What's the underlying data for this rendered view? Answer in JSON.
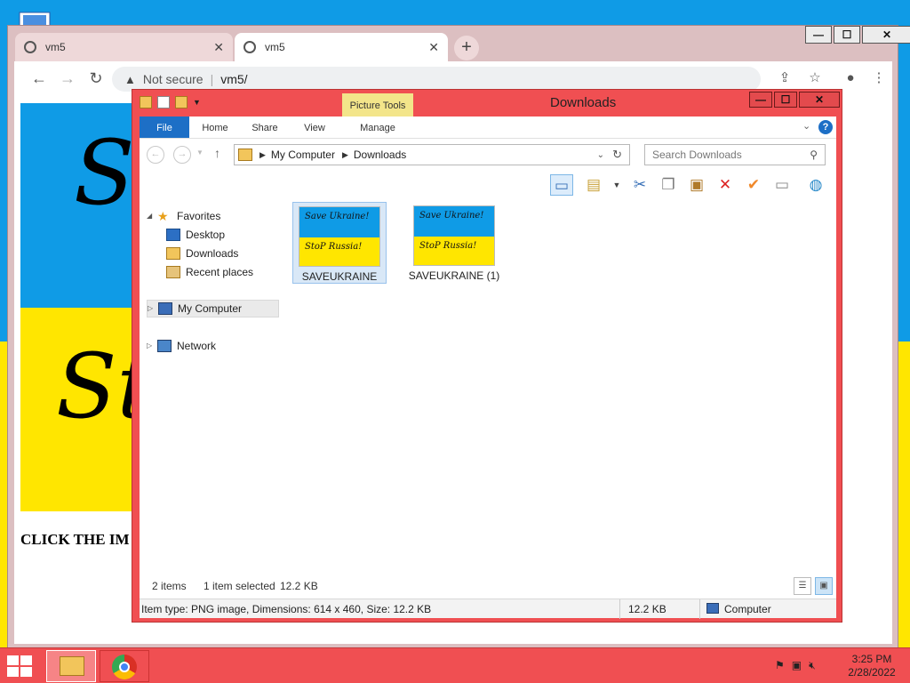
{
  "colors": {
    "accent_blue": "#1d6fc6",
    "wall_blue": "#0f9be6",
    "wall_yellow": "#ffe600",
    "explorer_frame": "#f04f52",
    "taskbar": "#f04f52"
  },
  "chrome": {
    "tabs": [
      {
        "title": "vm5",
        "icon": "globe-icon",
        "close": "✕"
      },
      {
        "title": "vm5",
        "icon": "globe-icon",
        "close": "✕"
      }
    ],
    "new_tab": "+",
    "window_controls": {
      "minimize": "—",
      "maximize": "☐",
      "close": "✕"
    },
    "omnibox": {
      "security": "Not secure",
      "url": "vm5/"
    },
    "page": {
      "heading": "CLICK THE IM",
      "banner_top": "Sa",
      "banner_bottom": "St"
    }
  },
  "explorer": {
    "title": "Downloads",
    "window_controls": {
      "minimize": "—",
      "maximize": "☐",
      "close": "✕"
    },
    "contextual_tab_group": "Picture Tools",
    "ribbon_tabs": [
      "File",
      "Home",
      "Share",
      "View",
      "Manage"
    ],
    "breadcrumb": [
      "My Computer",
      "Downloads"
    ],
    "search_placeholder": "Search Downloads",
    "nav": {
      "favorites": "Favorites",
      "favorites_items": [
        "Desktop",
        "Downloads",
        "Recent places"
      ],
      "my_computer": "My Computer",
      "network": "Network"
    },
    "files": [
      {
        "name": "SAVEUKRAINE",
        "line1": "Save Ukraine!",
        "line2": "StoP Russia!",
        "selected": true
      },
      {
        "name": "SAVEUKRAINE (1)",
        "line1": "Save Ukraine!",
        "line2": "StoP Russia!",
        "selected": false
      }
    ],
    "status": {
      "items": "2 items",
      "selected": "1 item selected",
      "size": "12.2 KB"
    },
    "info": {
      "details": "Item type: PNG image, Dimensions: 614 x 460, Size: 12.2 KB",
      "size": "12.2 KB",
      "location": "Computer"
    }
  },
  "taskbar": {
    "time": "3:25 PM",
    "date": "2/28/2022"
  }
}
